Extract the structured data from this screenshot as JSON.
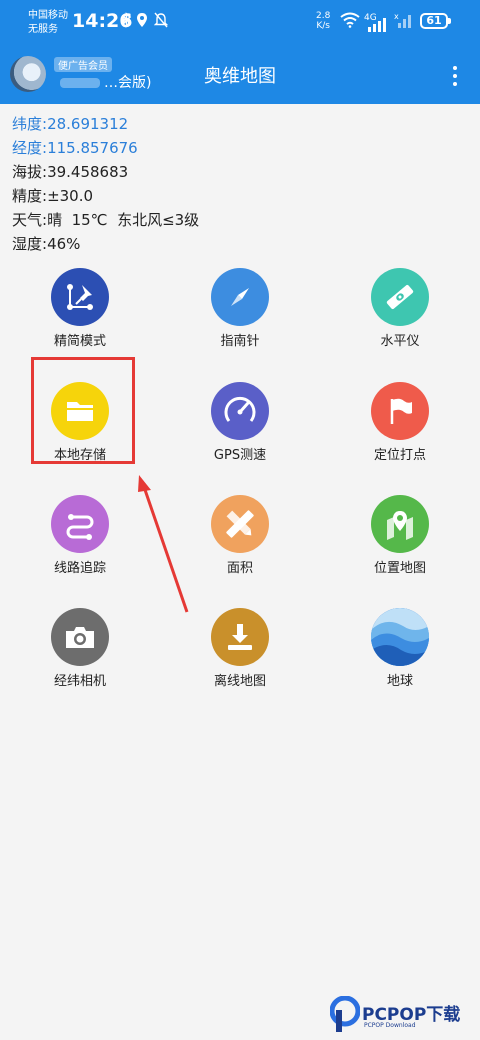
{
  "status_bar": {
    "carrier_line1": "中国移动",
    "carrier_line2": "无服务",
    "time": "14:26",
    "net_speed_value": "2.8",
    "net_speed_unit": "K/s",
    "network_type": "4G",
    "battery": "61",
    "icons": [
      "bluetooth-icon",
      "location-icon",
      "mute-bell-icon",
      "wifi-icon",
      "signal-icon",
      "no-signal-icon",
      "battery-icon"
    ]
  },
  "app_bar": {
    "badge": "便广告会员",
    "edition": "…会版)",
    "title": "奥维地图",
    "menu_icon": "more-vert-icon"
  },
  "info": {
    "latitude_label": "纬度:",
    "latitude_value": "28.691312",
    "longitude_label": "经度:",
    "longitude_value": "115.857676",
    "altitude_label": "海拔:",
    "altitude_value": "39.458683",
    "accuracy_label": "精度:",
    "accuracy_value": "±30.0",
    "weather_label": "天气:",
    "weather_value": "晴  15℃  东北风≤3级",
    "humidity_label": "湿度:",
    "humidity_value": "46%"
  },
  "tiles": [
    {
      "label": "精简模式",
      "icon": "pin-ruler-icon",
      "color": "#2c4fb3"
    },
    {
      "label": "指南针",
      "icon": "compass-icon",
      "color": "#3d8de0"
    },
    {
      "label": "水平仪",
      "icon": "level-icon",
      "color": "#3ec6b0"
    },
    {
      "label": "本地存储",
      "icon": "folder-icon",
      "color": "#f6d40b"
    },
    {
      "label": "GPS测速",
      "icon": "speedometer-icon",
      "color": "#5a5fc8"
    },
    {
      "label": "定位打点",
      "icon": "flag-icon",
      "color": "#ef5b4b"
    },
    {
      "label": "线路追踪",
      "icon": "route-icon",
      "color": "#b86bd6"
    },
    {
      "label": "面积",
      "icon": "ruler-pencil-icon",
      "color": "#f0a25e"
    },
    {
      "label": "位置地图",
      "icon": "map-pin-icon",
      "color": "#55b84a"
    },
    {
      "label": "经纬相机",
      "icon": "camera-icon",
      "color": "#6d6d6d"
    },
    {
      "label": "离线地图",
      "icon": "download-icon",
      "color": "#c9902b"
    },
    {
      "label": "地球",
      "icon": "wave-globe-icon",
      "color": "#2b7fd9"
    }
  ],
  "annotation": {
    "highlight_color": "#e53935"
  },
  "watermark": {
    "brand": "PCPOP下载",
    "sub": "PCPOP Download"
  }
}
